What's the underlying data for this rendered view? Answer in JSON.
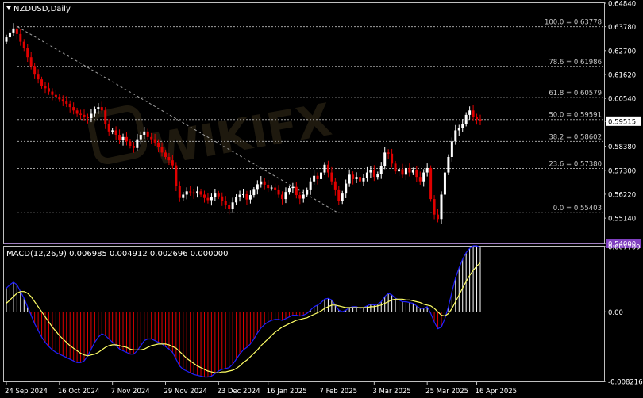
{
  "symbol_title": "NZDUSD,Daily",
  "macd_title": "MACD(12,26,9) 0.006985 0.004912 0.002696 0.000000",
  "watermark": "WIKIFX",
  "colors": {
    "background": "#000000",
    "frame": "#c0c0c0",
    "bull": "#ffffff",
    "bear": "#e00000",
    "fib": "#a0a0a0",
    "macd_line": "#2020ff",
    "signal_line": "#ffff66",
    "current_price_box": "#ffffff",
    "alert_box": "#8040c0"
  },
  "chart_data": [
    {
      "type": "candlestick",
      "title": "NZDUSD,Daily",
      "ylim": [
        0.54,
        0.6484
      ],
      "y_ticks": [
        "0.64840",
        "0.63780",
        "0.62700",
        "0.61620",
        "0.60540",
        "0.59510",
        "0.58380",
        "0.57300",
        "0.56220",
        "0.55140",
        "0.54000"
      ],
      "x_ticks": [
        "24 Sep 2024",
        "16 Oct 2024",
        "7 Nov 2024",
        "29 Nov 2024",
        "23 Dec 2024",
        "16 Jan 2025",
        "7 Feb 2025",
        "3 Mar 2025",
        "25 Mar 2025",
        "16 Apr 2025"
      ],
      "current_price": "0.59515",
      "alert_level": "0.54000",
      "fib_levels": [
        {
          "label": "100.0 = 0.63778",
          "value": 0.63778
        },
        {
          "label": "78.6 = 0.61986",
          "value": 0.61986
        },
        {
          "label": "61.8 = 0.60579",
          "value": 0.60579
        },
        {
          "label": "50.0 = 0.59591",
          "value": 0.59591
        },
        {
          "label": "38.2 = 0.58602",
          "value": 0.58602
        },
        {
          "label": "23.6 = 0.57380",
          "value": 0.5738
        },
        {
          "label": "0.0 = 0.55403",
          "value": 0.55403
        }
      ],
      "fib_anchor": {
        "start": 0.6378,
        "end": 0.554
      },
      "closes": [
        0.633,
        0.6352,
        0.637,
        0.6345,
        0.631,
        0.628,
        0.624,
        0.62,
        0.6165,
        0.614,
        0.611,
        0.61,
        0.6085,
        0.607,
        0.6062,
        0.605,
        0.604,
        0.603,
        0.6015,
        0.6,
        0.5985,
        0.598,
        0.597,
        0.5965,
        0.5985,
        0.6005,
        0.6015,
        0.6,
        0.594,
        0.5905,
        0.591,
        0.589,
        0.5865,
        0.588,
        0.586,
        0.584,
        0.583,
        0.587,
        0.589,
        0.5905,
        0.588,
        0.587,
        0.5855,
        0.5835,
        0.581,
        0.579,
        0.5775,
        0.5752,
        0.566,
        0.5605,
        0.562,
        0.5635,
        0.563,
        0.5625,
        0.5635,
        0.562,
        0.5605,
        0.5595,
        0.561,
        0.5625,
        0.5612,
        0.559,
        0.5572,
        0.5555,
        0.5585,
        0.561,
        0.562,
        0.5622,
        0.5598,
        0.5618,
        0.5642,
        0.5667,
        0.568,
        0.5665,
        0.565,
        0.5652,
        0.564,
        0.562,
        0.56,
        0.5632,
        0.565,
        0.5655,
        0.5618,
        0.5602,
        0.562,
        0.564,
        0.568,
        0.5705,
        0.569,
        0.572,
        0.5755,
        0.572,
        0.568,
        0.564,
        0.559,
        0.5625,
        0.567,
        0.571,
        0.569,
        0.57,
        0.568,
        0.5695,
        0.572,
        0.5732,
        0.57,
        0.5712,
        0.575,
        0.581,
        0.5805,
        0.576,
        0.5725,
        0.5735,
        0.571,
        0.574,
        0.572,
        0.573,
        0.57,
        0.568,
        0.572,
        0.574,
        0.56,
        0.553,
        0.551,
        0.562,
        0.572,
        0.579,
        0.586,
        0.591,
        0.592,
        0.594,
        0.598,
        0.6,
        0.597,
        0.596,
        0.5951
      ],
      "macd": {
        "ylim": [
          -0.008216,
          0.007709
        ],
        "y_ticks": [
          "0.007709",
          "0.00",
          "-0.008216"
        ],
        "macd_line": [
          0.0028,
          0.0032,
          0.0035,
          0.0032,
          0.0024,
          0.0016,
          0.0006,
          -0.0004,
          -0.0014,
          -0.0022,
          -0.003,
          -0.0036,
          -0.0041,
          -0.0045,
          -0.0048,
          -0.005,
          -0.0052,
          -0.0054,
          -0.0056,
          -0.0058,
          -0.006,
          -0.006,
          -0.0058,
          -0.0052,
          -0.0044,
          -0.0036,
          -0.003,
          -0.0026,
          -0.0028,
          -0.0032,
          -0.0036,
          -0.004,
          -0.0044,
          -0.0046,
          -0.0048,
          -0.005,
          -0.005,
          -0.0046,
          -0.004,
          -0.0034,
          -0.0032,
          -0.0032,
          -0.0034,
          -0.0036,
          -0.0038,
          -0.0041,
          -0.0044,
          -0.0048,
          -0.0056,
          -0.0064,
          -0.0068,
          -0.007,
          -0.0072,
          -0.0074,
          -0.0075,
          -0.0076,
          -0.0077,
          -0.0077,
          -0.0076,
          -0.0073,
          -0.007,
          -0.0068,
          -0.0067,
          -0.0066,
          -0.0062,
          -0.0056,
          -0.005,
          -0.0045,
          -0.0042,
          -0.0038,
          -0.0032,
          -0.0025,
          -0.0019,
          -0.0015,
          -0.0012,
          -0.001,
          -0.0009,
          -0.0009,
          -0.001,
          -0.0008,
          -0.0006,
          -0.0004,
          -0.0004,
          -0.0005,
          -0.0004,
          -0.0002,
          0.0002,
          0.0006,
          0.0008,
          0.0011,
          0.0015,
          0.0016,
          0.0014,
          0.0008,
          0.0002,
          0.0,
          0.0002,
          0.0005,
          0.0006,
          0.0006,
          0.0004,
          0.0005,
          0.0007,
          0.0009,
          0.0008,
          0.0009,
          0.0012,
          0.0018,
          0.0022,
          0.002,
          0.0016,
          0.0014,
          0.0012,
          0.0012,
          0.0011,
          0.001,
          0.0007,
          0.0004,
          0.0004,
          0.0006,
          -0.0002,
          -0.0012,
          -0.002,
          -0.0018,
          -0.0008,
          0.0006,
          0.0024,
          0.004,
          0.0052,
          0.0062,
          0.007,
          0.0075,
          0.0078,
          0.0078,
          0.0076
        ],
        "signal_line": [
          0.001,
          0.0014,
          0.0018,
          0.0022,
          0.0024,
          0.0024,
          0.0022,
          0.0018,
          0.0012,
          0.0006,
          0.0,
          -0.0006,
          -0.0012,
          -0.0018,
          -0.0023,
          -0.0028,
          -0.0032,
          -0.0036,
          -0.004,
          -0.0043,
          -0.0046,
          -0.0049,
          -0.0051,
          -0.0052,
          -0.0051,
          -0.005,
          -0.0048,
          -0.0045,
          -0.0042,
          -0.004,
          -0.0039,
          -0.0039,
          -0.004,
          -0.0041,
          -0.0042,
          -0.0044,
          -0.0045,
          -0.0045,
          -0.0045,
          -0.0044,
          -0.0042,
          -0.004,
          -0.0039,
          -0.0038,
          -0.0038,
          -0.0038,
          -0.0039,
          -0.0041,
          -0.0043,
          -0.0047,
          -0.0051,
          -0.0055,
          -0.0058,
          -0.0061,
          -0.0064,
          -0.0066,
          -0.0068,
          -0.007,
          -0.0071,
          -0.0072,
          -0.0072,
          -0.0071,
          -0.0071,
          -0.007,
          -0.0069,
          -0.0067,
          -0.0064,
          -0.006,
          -0.0057,
          -0.0053,
          -0.0049,
          -0.0045,
          -0.004,
          -0.0036,
          -0.0032,
          -0.0028,
          -0.0024,
          -0.0021,
          -0.0018,
          -0.0016,
          -0.0014,
          -0.0012,
          -0.001,
          -0.0009,
          -0.0008,
          -0.0007,
          -0.0005,
          -0.0003,
          -0.0001,
          0.0001,
          0.0004,
          0.0006,
          0.0008,
          0.0008,
          0.0007,
          0.0006,
          0.0005,
          0.0005,
          0.0005,
          0.0005,
          0.0005,
          0.0005,
          0.0005,
          0.0006,
          0.0006,
          0.0007,
          0.0008,
          0.001,
          0.0012,
          0.0014,
          0.0015,
          0.0015,
          0.0015,
          0.0014,
          0.0014,
          0.0013,
          0.0012,
          0.0011,
          0.0009,
          0.0008,
          0.0007,
          0.0004,
          0.0,
          -0.0004,
          -0.0005,
          -0.0002,
          0.0004,
          0.0012,
          0.002,
          0.0028,
          0.0036,
          0.0043,
          0.0049,
          0.0054,
          0.0058
        ]
      }
    }
  ]
}
